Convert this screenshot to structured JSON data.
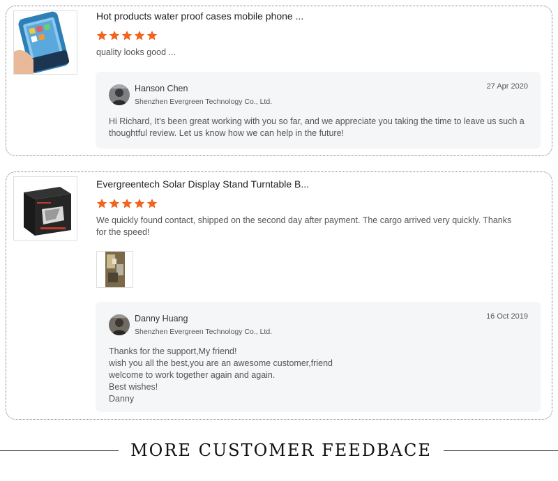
{
  "reviews": [
    {
      "product_title": "Hot products water proof cases mobile phone ...",
      "rating": 5,
      "review_text": "quality looks good ...",
      "reply": {
        "name": "Hanson Chen",
        "company": "Shenzhen Evergreen Technology Co., Ltd.",
        "date": "27 Apr 2020",
        "message": "Hi Richard, It's been great working with you so far, and we appreciate you taking the time to leave us such a thoughtful review. Let us know how we can help in the future!"
      }
    },
    {
      "product_title": "Evergreentech Solar Display Stand Turntable B...",
      "rating": 5,
      "review_text": "We quickly found contact, shipped on the second day after payment.  The cargo arrived very quickly.  Thanks for the speed!",
      "reply": {
        "name": "Danny Huang",
        "company": "Shenzhen Evergreen Technology Co., Ltd.",
        "date": "16 Oct 2019",
        "message_lines": [
          "Thanks for the support,My friend!",
          "wish you all the best,you are an awesome customer,friend",
          "welcome to work together again and again.",
          "Best wishes!",
          "Danny"
        ]
      }
    }
  ],
  "footer": {
    "text": "MORE CUSTOMER FEEDBACE"
  },
  "colors": {
    "star": "#f1641e",
    "reply_bg": "#f5f6f8"
  }
}
